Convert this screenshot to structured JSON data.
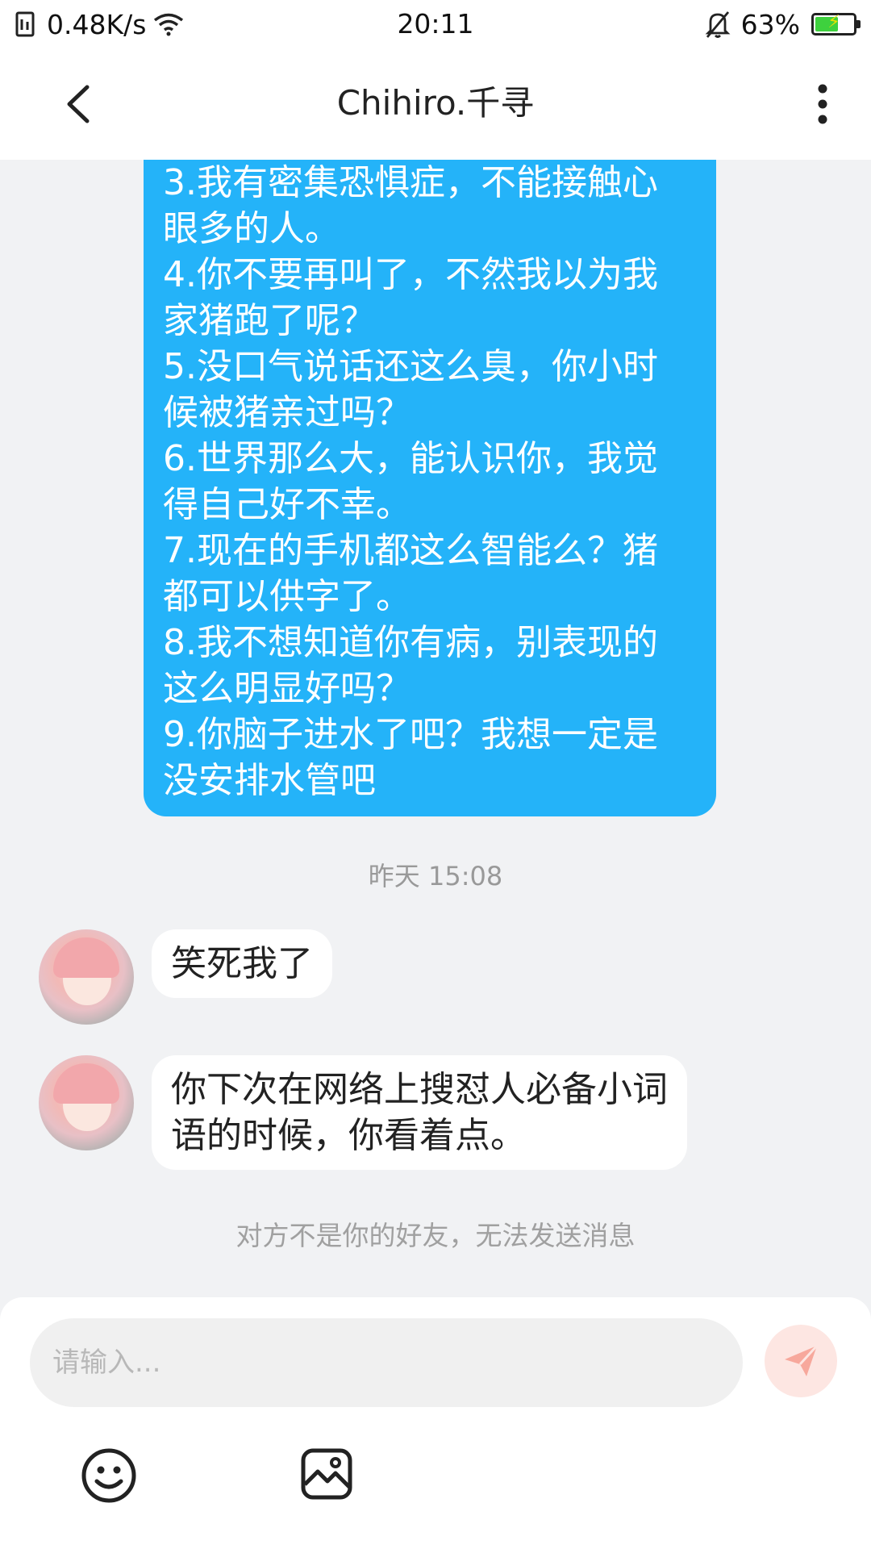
{
  "status_bar": {
    "net_speed": "0.48K/s",
    "time": "20:11",
    "battery": "63%",
    "battery_level": 0.63,
    "icons": [
      "data-saver-icon",
      "wifi-icon",
      "mute-bell-icon",
      "battery-icon"
    ]
  },
  "header": {
    "title": "Chihiro.千寻",
    "icons": [
      "back-arrow-icon",
      "more-vertical-icon"
    ]
  },
  "messages": {
    "sent": {
      "lines": [
        "3.我有密集恐惧症，不能接触心",
        "眼多的人。",
        "4.你不要再叫了，不然我以为我",
        "家猪跑了呢？",
        "5.没口气说话还这么臭，你小时",
        "候被猪亲过吗？",
        "6.世界那么大，能认识你，我觉",
        "得自己好不幸。",
        "7.现在的手机都这么智能么？猪",
        "都可以供字了。",
        "8.我不想知道你有病，别表现的",
        "这么明显好吗？",
        "9.你脑子进水了吧？我想一定是",
        "没安排水管吧"
      ],
      "color": "#24b3f9"
    },
    "timestamp": "昨天 15:08",
    "received": [
      {
        "lines": [
          "笑死我了"
        ]
      },
      {
        "lines": [
          "你下次在网络上搜怼人必备小词",
          "语的时候，你看着点。"
        ]
      }
    ],
    "system_note": "对方不是你的好友，无法发送消息"
  },
  "composer": {
    "placeholder": "请输入...",
    "icons": [
      "send-icon",
      "emoji-icon",
      "image-icon"
    ],
    "send_color": "#f58a7a"
  }
}
